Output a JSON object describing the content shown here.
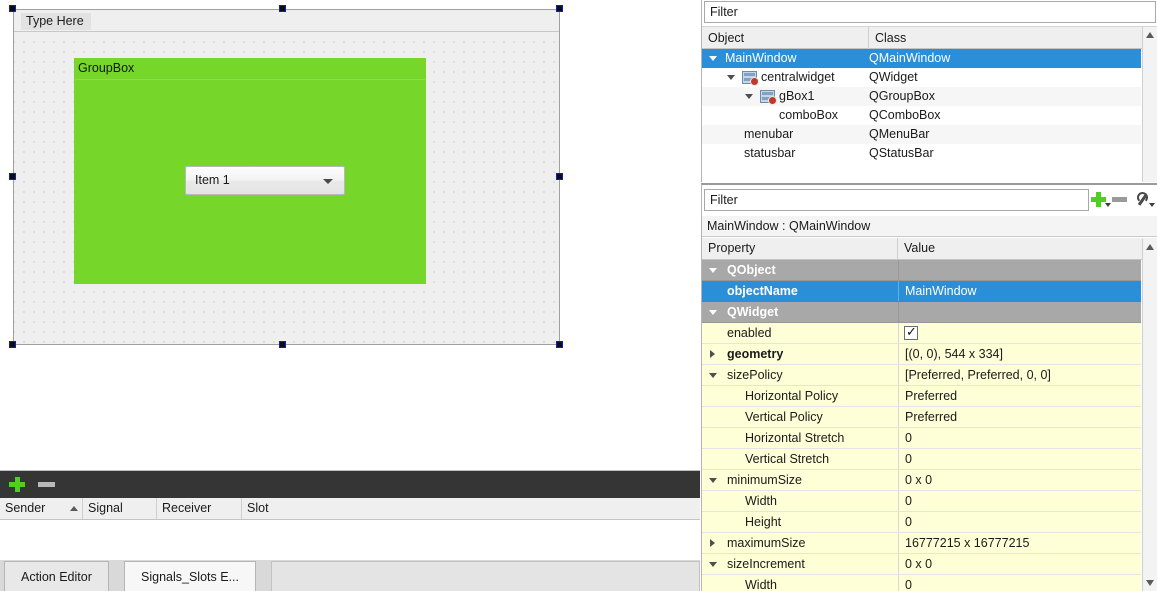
{
  "designer": {
    "menubar_placeholder": "Type Here",
    "groupbox_title": "GroupBox",
    "groupbox_color": "#76d62a",
    "combobox_value": "Item 1",
    "selection_handle_color": "#1414e6"
  },
  "signals_slots": {
    "toolbar": {
      "add_icon": "plus-icon",
      "remove_icon": "minus-icon"
    },
    "columns": [
      "Sender",
      "Signal",
      "Receiver",
      "Slot"
    ],
    "sort_column": "Sender",
    "rows": [],
    "tabs": [
      {
        "label": "Action Editor",
        "active": false
      },
      {
        "label": "Signals_Slots E...",
        "active": true
      }
    ]
  },
  "object_inspector": {
    "filter_placeholder": "Filter",
    "filter_value": "",
    "columns": [
      "Object",
      "Class"
    ],
    "rows": [
      {
        "object": "MainWindow",
        "class": "QMainWindow",
        "depth": 0,
        "expander": "expanded",
        "icon": null,
        "selected": true
      },
      {
        "object": "centralwidget",
        "class": "QWidget",
        "depth": 1,
        "expander": "expanded",
        "icon": "no-layout-icon",
        "selected": false
      },
      {
        "object": "gBox1",
        "class": "QGroupBox",
        "depth": 2,
        "expander": "expanded",
        "icon": "no-layout-icon",
        "selected": false
      },
      {
        "object": "comboBox",
        "class": "QComboBox",
        "depth": 3,
        "expander": "none",
        "icon": null,
        "selected": false
      },
      {
        "object": "menubar",
        "class": "QMenuBar",
        "depth": 1,
        "expander": "none",
        "icon": null,
        "selected": false
      },
      {
        "object": "statusbar",
        "class": "QStatusBar",
        "depth": 1,
        "expander": "none",
        "icon": null,
        "selected": false
      }
    ]
  },
  "property_editor": {
    "filter_placeholder": "Filter",
    "filter_value": "",
    "tools": [
      "add-property-icon",
      "remove-property-icon",
      "configure-icon"
    ],
    "object_line": "MainWindow : QMainWindow",
    "columns": [
      "Property",
      "Value"
    ],
    "rows": [
      {
        "name": "QObject",
        "value": "",
        "kind": "group",
        "depth": 0,
        "expander": "expanded"
      },
      {
        "name": "objectName",
        "value": "MainWindow",
        "kind": "sel",
        "depth": 1,
        "expander": "none"
      },
      {
        "name": "QWidget",
        "value": "",
        "kind": "group",
        "depth": 0,
        "expander": "expanded"
      },
      {
        "name": "enabled",
        "value": "",
        "kind": "check",
        "depth": 1,
        "expander": "none",
        "checked": true
      },
      {
        "name": "geometry",
        "value": "[(0, 0), 544 x 334]",
        "kind": "bold",
        "depth": 1,
        "expander": "collapsed"
      },
      {
        "name": "sizePolicy",
        "value": "[Preferred, Preferred, 0, 0]",
        "kind": "plain",
        "depth": 1,
        "expander": "expanded"
      },
      {
        "name": "Horizontal Policy",
        "value": "Preferred",
        "kind": "plain",
        "depth": 2,
        "expander": "none"
      },
      {
        "name": "Vertical Policy",
        "value": "Preferred",
        "kind": "plain",
        "depth": 2,
        "expander": "none"
      },
      {
        "name": "Horizontal Stretch",
        "value": "0",
        "kind": "plain",
        "depth": 2,
        "expander": "none"
      },
      {
        "name": "Vertical Stretch",
        "value": "0",
        "kind": "plain",
        "depth": 2,
        "expander": "none"
      },
      {
        "name": "minimumSize",
        "value": "0 x 0",
        "kind": "plain",
        "depth": 1,
        "expander": "expanded"
      },
      {
        "name": "Width",
        "value": "0",
        "kind": "plain",
        "depth": 2,
        "expander": "none"
      },
      {
        "name": "Height",
        "value": "0",
        "kind": "plain",
        "depth": 2,
        "expander": "none"
      },
      {
        "name": "maximumSize",
        "value": "16777215 x 16777215",
        "kind": "plain",
        "depth": 1,
        "expander": "collapsed"
      },
      {
        "name": "sizeIncrement",
        "value": "0 x 0",
        "kind": "plain",
        "depth": 1,
        "expander": "expanded"
      },
      {
        "name": "Width",
        "value": "0",
        "kind": "plain",
        "depth": 2,
        "expander": "none"
      }
    ]
  }
}
